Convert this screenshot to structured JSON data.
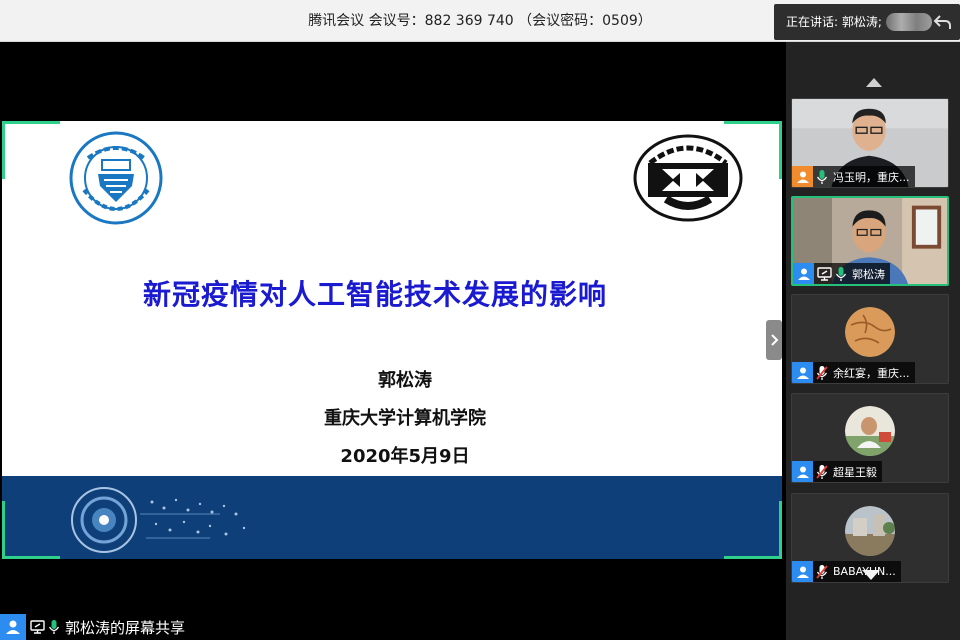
{
  "window": {
    "title": "腾讯会议 会议号：882 369 740 （会议密码：0509）",
    "speaking_label": "正在讲话: 郭松涛;"
  },
  "slide": {
    "title": "新冠疫情对人工智能技术发展的影响",
    "presenter": "郭松涛",
    "institution": "重庆大学计算机学院",
    "date": "2020年5月9日",
    "left_logo": "重庆大学 CHONGQING UNIVERSITY 1929",
    "right_logo": "中国计算机学会 CCF",
    "colors": {
      "title": "#1a1ad0",
      "banner": "#0e3f78",
      "frame_corner": "#2ed08c"
    }
  },
  "participants": [
    {
      "name": "冯玉明，重庆...",
      "icon": "user-icon",
      "icon_color": "#f08c2d",
      "mic": "mic-on",
      "share": false,
      "active": false
    },
    {
      "name": "郭松涛",
      "icon": "user-icon",
      "icon_color": "#2d8cf0",
      "mic": "mic-on",
      "share": true,
      "active": true
    },
    {
      "name": "余红宴，重庆...",
      "icon": "user-icon",
      "icon_color": "#2d8cf0",
      "mic": "mic-off",
      "share": false,
      "active": false
    },
    {
      "name": "超星王毅",
      "icon": "user-icon",
      "icon_color": "#2d8cf0",
      "mic": "mic-off",
      "share": false,
      "active": false
    },
    {
      "name": "BABAYUN...",
      "icon": "user-icon",
      "icon_color": "#2d8cf0",
      "mic": "mic-off",
      "share": false,
      "active": false
    }
  ],
  "status": {
    "share_label": "郭松涛的屏幕共享"
  },
  "icons": {
    "back": "back-arrow-icon",
    "expand": "chevron-right-icon",
    "scroll_up": "triangle-up-icon",
    "scroll_down": "triangle-down-icon"
  }
}
